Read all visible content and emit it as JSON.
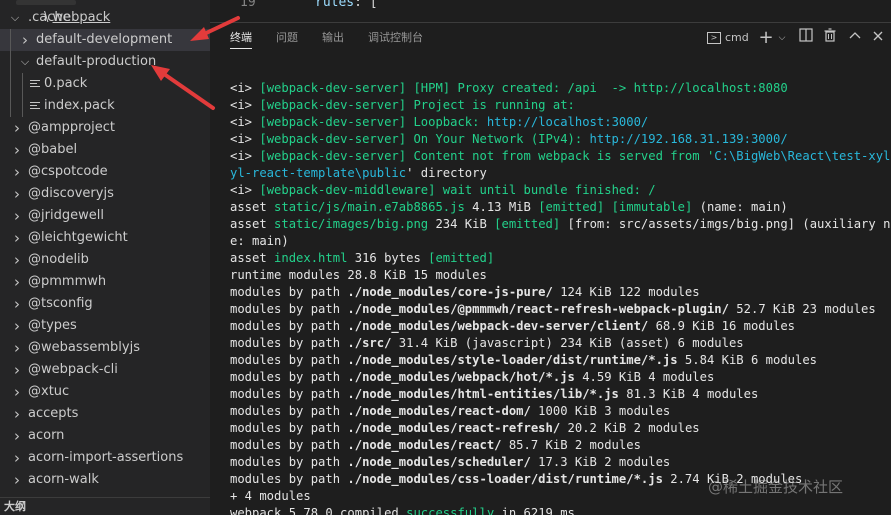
{
  "explorer": {
    "rows": [
      {
        "chevron": "v",
        "label": ".cache",
        "sep": " \\ ",
        "label2": "webpack",
        "selected": false
      },
      {
        "chevron": ">",
        "label": "default-development",
        "selected": true
      },
      {
        "chevron": "v",
        "label": "default-production",
        "selected": false
      },
      {
        "chevron": "",
        "label": "0.pack",
        "selected": false
      },
      {
        "chevron": "",
        "label": "index.pack",
        "selected": false
      },
      {
        "chevron": ">",
        "label": "@ampproject"
      },
      {
        "chevron": ">",
        "label": "@babel"
      },
      {
        "chevron": ">",
        "label": "@cspotcode"
      },
      {
        "chevron": ">",
        "label": "@discoveryjs"
      },
      {
        "chevron": ">",
        "label": "@jridgewell"
      },
      {
        "chevron": ">",
        "label": "@leichtgewicht"
      },
      {
        "chevron": ">",
        "label": "@nodelib"
      },
      {
        "chevron": ">",
        "label": "@pmmmwh"
      },
      {
        "chevron": ">",
        "label": "@tsconfig"
      },
      {
        "chevron": ">",
        "label": "@types"
      },
      {
        "chevron": ">",
        "label": "@webassemblyjs"
      },
      {
        "chevron": ">",
        "label": "@webpack-cli"
      },
      {
        "chevron": ">",
        "label": "@xtuc"
      },
      {
        "chevron": ">",
        "label": "accepts"
      },
      {
        "chevron": ">",
        "label": "acorn"
      },
      {
        "chevron": ">",
        "label": "acorn-import-assertions"
      },
      {
        "chevron": ">",
        "label": "acorn-walk"
      }
    ],
    "outline_label": "大纲"
  },
  "editor": {
    "line_number": "19",
    "code_key": "rules",
    "code_punct": ": ["
  },
  "panel": {
    "tabs": [
      "终端",
      "问题",
      "输出",
      "调试控制台"
    ],
    "active_tab": "终端",
    "terminal_selector": "cmd",
    "add_icon": "plus-icon",
    "split_icon": "split-icon",
    "trash_icon": "trash-icon",
    "maximize_icon": "chevron-up-icon",
    "close_icon": "close-icon"
  },
  "terminal": {
    "lines": [
      [
        [
          "w",
          "<i> "
        ],
        [
          "g",
          "[webpack-dev-server]"
        ],
        [
          "g",
          " [HPM] Proxy created: /api  -> http://localhost:8080"
        ]
      ],
      [
        [
          "w",
          "<i> "
        ],
        [
          "g",
          "[webpack-dev-server]"
        ],
        [
          "g",
          " Project is running at:"
        ]
      ],
      [
        [
          "w",
          "<i> "
        ],
        [
          "g",
          "[webpack-dev-server]"
        ],
        [
          "g",
          " Loopback: "
        ],
        [
          "c",
          "http://localhost:3000/"
        ]
      ],
      [
        [
          "w",
          "<i> "
        ],
        [
          "g",
          "[webpack-dev-server]"
        ],
        [
          "g",
          " On Your Network (IPv4): "
        ],
        [
          "c",
          "http://192.168.31.139:3000/"
        ]
      ],
      [
        [
          "w",
          "<i> "
        ],
        [
          "g",
          "[webpack-dev-server]"
        ],
        [
          "g",
          " Content not from webpack is served from '"
        ],
        [
          "c",
          "C:\\BigWeb\\React\\test-xyl\\x"
        ]
      ],
      [
        [
          "c",
          "yl-react-template\\public"
        ],
        [
          "w",
          "' directory"
        ]
      ],
      [
        [
          "w",
          "<i> "
        ],
        [
          "g",
          "[webpack-dev-middleware]"
        ],
        [
          "g",
          " wait until bundle finished: /"
        ]
      ],
      [
        [
          "w",
          "asset "
        ],
        [
          "g",
          "static/js/main.e7ab8865.js"
        ],
        [
          "w",
          " 4.13 MiB "
        ],
        [
          "g",
          "[emitted]"
        ],
        [
          "w",
          " "
        ],
        [
          "g",
          "[immutable]"
        ],
        [
          "w",
          " (name: main)"
        ]
      ],
      [
        [
          "w",
          "asset "
        ],
        [
          "g",
          "static/images/big.png"
        ],
        [
          "w",
          " 234 KiB "
        ],
        [
          "g",
          "[emitted]"
        ],
        [
          "w",
          " [from: src/assets/imgs/big.png] (auxiliary nam"
        ]
      ],
      [
        [
          "w",
          "e: main)"
        ]
      ],
      [
        [
          "w",
          "asset "
        ],
        [
          "g",
          "index.html"
        ],
        [
          "w",
          " 316 bytes "
        ],
        [
          "g",
          "[emitted]"
        ]
      ],
      [
        [
          "w",
          "runtime modules 28.8 KiB 15 modules"
        ]
      ],
      [
        [
          "w",
          "modules by path "
        ],
        [
          "b",
          "./node_modules/core-js-pure/"
        ],
        [
          "w",
          " 124 KiB 122 modules"
        ]
      ],
      [
        [
          "w",
          "modules by path "
        ],
        [
          "b",
          "./node_modules/@pmmmwh/react-refresh-webpack-plugin/"
        ],
        [
          "w",
          " 52.7 KiB 23 modules"
        ]
      ],
      [
        [
          "w",
          "modules by path "
        ],
        [
          "b",
          "./node_modules/webpack-dev-server/client/"
        ],
        [
          "w",
          " 68.9 KiB 16 modules"
        ]
      ],
      [
        [
          "w",
          "modules by path "
        ],
        [
          "b",
          "./src/"
        ],
        [
          "w",
          " 31.4 KiB (javascript) 234 KiB (asset) 6 modules"
        ]
      ],
      [
        [
          "w",
          "modules by path "
        ],
        [
          "b",
          "./node_modules/style-loader/dist/runtime/*.js"
        ],
        [
          "w",
          " 5.84 KiB 6 modules"
        ]
      ],
      [
        [
          "w",
          "modules by path "
        ],
        [
          "b",
          "./node_modules/webpack/hot/*.js"
        ],
        [
          "w",
          " 4.59 KiB 4 modules"
        ]
      ],
      [
        [
          "w",
          "modules by path "
        ],
        [
          "b",
          "./node_modules/html-entities/lib/*.js"
        ],
        [
          "w",
          " 81.3 KiB 4 modules"
        ]
      ],
      [
        [
          "w",
          "modules by path "
        ],
        [
          "b",
          "./node_modules/react-dom/"
        ],
        [
          "w",
          " 1000 KiB 3 modules"
        ]
      ],
      [
        [
          "w",
          "modules by path "
        ],
        [
          "b",
          "./node_modules/react-refresh/"
        ],
        [
          "w",
          " 20.2 KiB 2 modules"
        ]
      ],
      [
        [
          "w",
          "modules by path "
        ],
        [
          "b",
          "./node_modules/react/"
        ],
        [
          "w",
          " 85.7 KiB 2 modules"
        ]
      ],
      [
        [
          "w",
          "modules by path "
        ],
        [
          "b",
          "./node_modules/scheduler/"
        ],
        [
          "w",
          " 17.3 KiB 2 modules"
        ]
      ],
      [
        [
          "w",
          "modules by path "
        ],
        [
          "b",
          "./node_modules/css-loader/dist/runtime/*.js"
        ],
        [
          "w",
          " 2.74 KiB 2 modules"
        ]
      ],
      [
        [
          "w",
          "+ 4 modules"
        ]
      ],
      [
        [
          "w",
          "webpack 5.78.0 compiled "
        ],
        [
          "g",
          "successfully"
        ],
        [
          "w",
          " in 6219 ms"
        ]
      ]
    ]
  },
  "watermark": "@稀土掘金技术社区",
  "colors": {
    "accent_red": "#e23b3b",
    "terminal_green": "#23d18b",
    "terminal_cyan": "#29b8db"
  }
}
